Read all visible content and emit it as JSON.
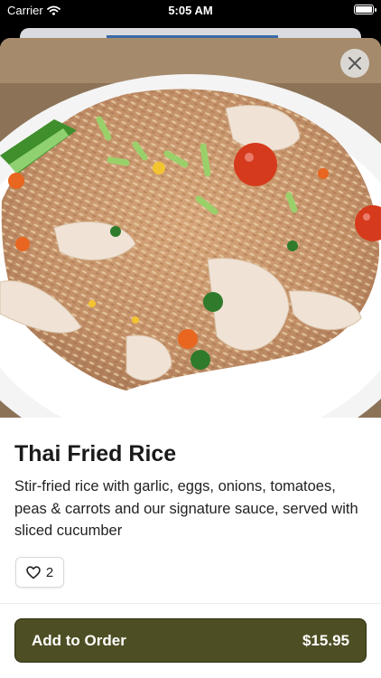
{
  "status_bar": {
    "carrier": "Carrier",
    "time": "5:05 AM"
  },
  "item": {
    "name": "Thai Fried Rice",
    "description": "Stir-fried rice with garlic, eggs, onions, tomatoes, peas & carrots and our signature sauce, served with sliced cucumber",
    "like_count": "2"
  },
  "order_button": {
    "label": "Add to Order",
    "price": "$15.95"
  },
  "colors": {
    "order_button_bg": "#4e4e24",
    "sheet_bg": "#ffffff"
  },
  "icons": [
    "wifi-icon",
    "battery-icon",
    "close-icon",
    "heart-icon"
  ]
}
